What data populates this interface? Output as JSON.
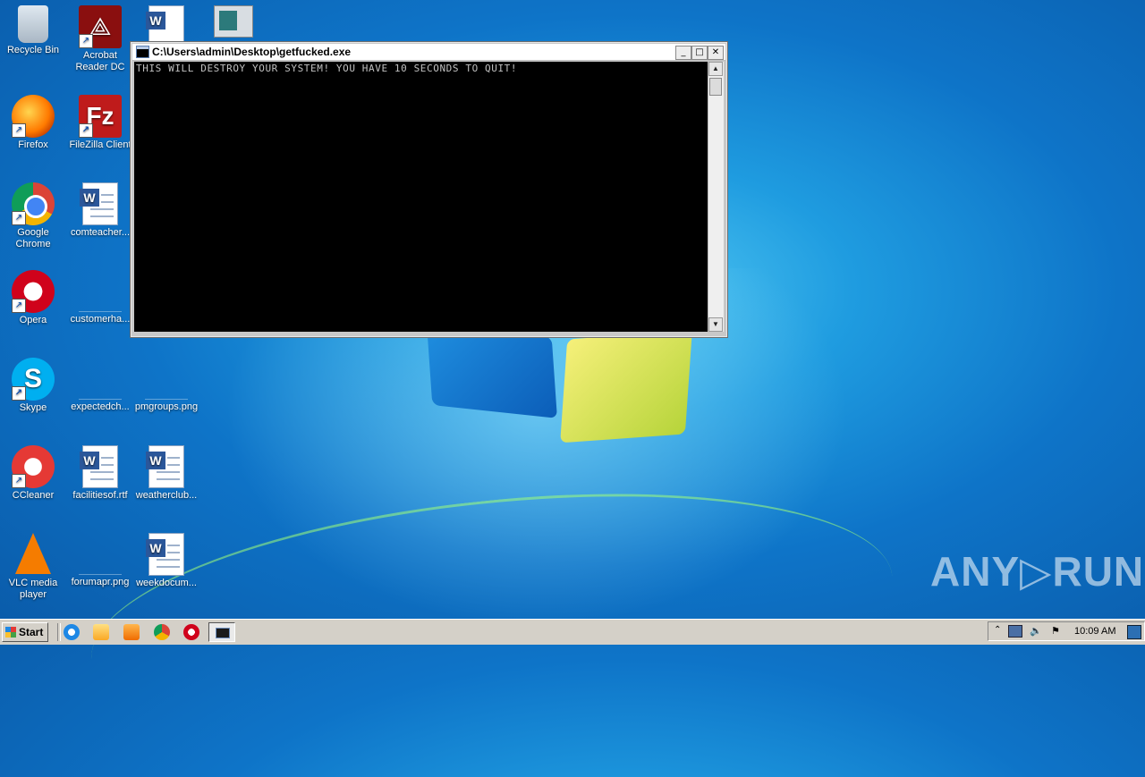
{
  "desktop": {
    "icons": [
      {
        "label": "Recycle Bin",
        "icon": "recycle-bin-icon"
      },
      {
        "label": "Acrobat Reader DC",
        "icon": "acrobat-icon"
      },
      {
        "label": "Firefox",
        "icon": "firefox-icon"
      },
      {
        "label": "FileZilla Client",
        "icon": "filezilla-icon"
      },
      {
        "label": "Google Chrome",
        "icon": "chrome-icon"
      },
      {
        "label": "comteacher...",
        "icon": "word-doc-icon"
      },
      {
        "label": "Opera",
        "icon": "opera-icon"
      },
      {
        "label": "customerha...",
        "icon": "blank-file-icon"
      },
      {
        "label": "Skype",
        "icon": "skype-icon"
      },
      {
        "label": "expectedch...",
        "icon": "blank-file-icon"
      },
      {
        "label": "pmgroups.png",
        "icon": "blank-file-icon"
      },
      {
        "label": "CCleaner",
        "icon": "ccleaner-icon"
      },
      {
        "label": "facilitiesof.rtf",
        "icon": "word-doc-icon"
      },
      {
        "label": "weatherclub...",
        "icon": "word-doc-icon"
      },
      {
        "label": "VLC media player",
        "icon": "vlc-icon"
      },
      {
        "label": "forumapr.png",
        "icon": "blank-file-icon"
      },
      {
        "label": "weekdocum...",
        "icon": "word-doc-icon"
      }
    ]
  },
  "console": {
    "title": "C:\\Users\\admin\\Desktop\\getfucked.exe",
    "output": "THIS WILL DESTROY YOUR SYSTEM! YOU HAVE 10 SECONDS TO QUIT!",
    "buttons": {
      "minimize": "_",
      "maximize": "□",
      "close": "✕"
    },
    "scroll_up": "▲",
    "scroll_down": "▼"
  },
  "watermark": "ANY▷RUN",
  "taskbar": {
    "start_label": "Start",
    "clock": "10:09 AM",
    "tray_expand": "⌃",
    "tray_volume": "🔈",
    "tray_flag": "⚑"
  }
}
